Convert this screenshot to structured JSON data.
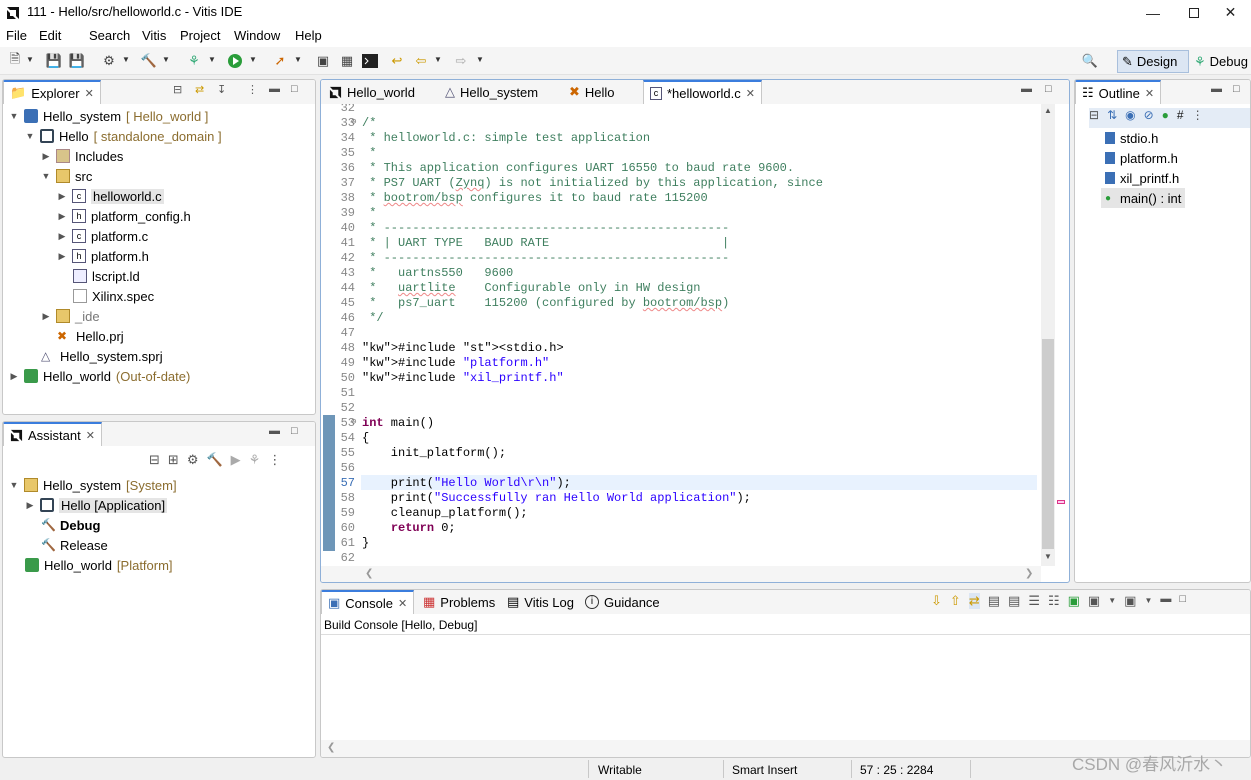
{
  "window": {
    "title": "111 - Hello/src/helloworld.c - Vitis IDE"
  },
  "menu": [
    "File",
    "Edit",
    "Search",
    "Vitis",
    "Project",
    "Window",
    "Help"
  ],
  "perspectives": {
    "design": "Design",
    "debug": "Debug"
  },
  "explorer": {
    "tab": "Explorer",
    "tree": [
      {
        "label": "Hello_system",
        "deco": "[ Hello_world ]"
      },
      {
        "label": "Hello",
        "deco": "[ standalone_domain ]"
      },
      {
        "label": "Includes",
        "deco": ""
      },
      {
        "label": "src",
        "deco": ""
      },
      {
        "label": "helloworld.c",
        "deco": ""
      },
      {
        "label": "platform_config.h",
        "deco": ""
      },
      {
        "label": "platform.c",
        "deco": ""
      },
      {
        "label": "platform.h",
        "deco": ""
      },
      {
        "label": "lscript.ld",
        "deco": ""
      },
      {
        "label": "Xilinx.spec",
        "deco": ""
      },
      {
        "label": "_ide",
        "deco": ""
      },
      {
        "label": "Hello.prj",
        "deco": ""
      },
      {
        "label": "Hello_system.sprj",
        "deco": ""
      },
      {
        "label": "Hello_world",
        "deco": "(Out-of-date)"
      }
    ]
  },
  "assistant": {
    "tab": "Assistant",
    "tree": [
      {
        "label": "Hello_system",
        "deco": "[System]"
      },
      {
        "label": "Hello [Application]",
        "deco": ""
      },
      {
        "label": "Debug",
        "deco": ""
      },
      {
        "label": "Release",
        "deco": ""
      },
      {
        "label": "Hello_world",
        "deco": "[Platform]"
      }
    ]
  },
  "editor": {
    "tabs": [
      "Hello_world",
      "Hello_system",
      "Hello",
      "*helloworld.c"
    ],
    "line_numbers": [
      "32",
      "33",
      "34",
      "35",
      "36",
      "37",
      "38",
      "39",
      "40",
      "41",
      "42",
      "43",
      "44",
      "45",
      "46",
      "47",
      "48",
      "49",
      "50",
      "51",
      "52",
      "53",
      "54",
      "55",
      "56",
      "57",
      "58",
      "59",
      "60",
      "61",
      "62"
    ],
    "lines": [
      "",
      "/*",
      " * helloworld.c: simple test application",
      " *",
      " * This application configures UART 16550 to baud rate 9600.",
      " * PS7 UART (Zynq) is not initialized by this application, since",
      " * bootrom/bsp configures it to baud rate 115200",
      " *",
      " * ------------------------------------------------",
      " * | UART TYPE   BAUD RATE                        |",
      " * ------------------------------------------------",
      " *   uartns550   9600",
      " *   uartlite    Configurable only in HW design",
      " *   ps7_uart    115200 (configured by bootrom/bsp)",
      " */",
      "",
      "#include <stdio.h>",
      "#include \"platform.h\"",
      "#include \"xil_printf.h\"",
      "",
      "",
      "int main()",
      "{",
      "    init_platform();",
      "",
      "    print(\"Hello World\\r\\n\");",
      "    print(\"Successfully ran Hello World application\");",
      "    cleanup_platform();",
      "    return 0;",
      "}",
      ""
    ]
  },
  "outline": {
    "tab": "Outline",
    "items": [
      "stdio.h",
      "platform.h",
      "xil_printf.h",
      "main() : int"
    ]
  },
  "console": {
    "tabs": [
      "Console",
      "Problems",
      "Vitis Log",
      "Guidance"
    ],
    "header": "Build Console [Hello, Debug]"
  },
  "status": {
    "writable": "Writable",
    "insert": "Smart Insert",
    "position": "57 : 25 : 2284"
  },
  "watermark": "CSDN @春风沂水丶",
  "colors": {
    "comment": "#3f7f5f",
    "keyword": "#7f0055",
    "string": "#2a00ff",
    "accent": "#3b7ddd"
  }
}
